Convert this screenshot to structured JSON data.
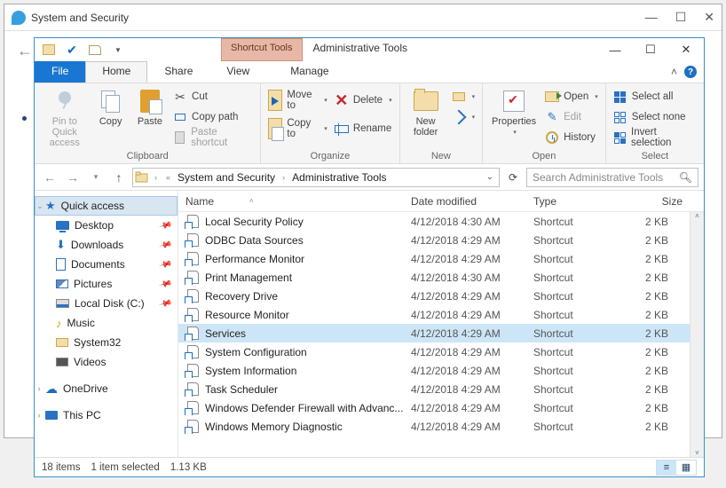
{
  "bg_window": {
    "title": "System and Security",
    "controls": {
      "min": "—",
      "max": "☐",
      "close": "✕"
    }
  },
  "window": {
    "context_tab": "Shortcut Tools",
    "title": "Administrative Tools",
    "controls": {
      "min": "—",
      "max": "☐",
      "close": "✕"
    }
  },
  "ribbon_tabs": {
    "file": "File",
    "home": "Home",
    "share": "Share",
    "view": "View",
    "manage": "Manage"
  },
  "ribbon": {
    "clipboard": {
      "label": "Clipboard",
      "pin": "Pin to Quick\naccess",
      "copy": "Copy",
      "paste": "Paste",
      "cut": "Cut",
      "copy_path": "Copy path",
      "paste_shortcut": "Paste shortcut"
    },
    "organize": {
      "label": "Organize",
      "move_to": "Move to",
      "copy_to": "Copy to",
      "delete": "Delete",
      "rename": "Rename"
    },
    "new": {
      "label": "New",
      "new_folder": "New\nfolder",
      "new_item": "New item",
      "easy_access": "Easy access"
    },
    "open": {
      "label": "Open",
      "properties": "Properties",
      "open": "Open",
      "edit": "Edit",
      "history": "History"
    },
    "select": {
      "label": "Select",
      "select_all": "Select all",
      "select_none": "Select none",
      "invert": "Invert selection"
    }
  },
  "addrbar": {
    "crumbs": [
      "System and Security",
      "Administrative Tools"
    ],
    "search_placeholder": "Search Administrative Tools"
  },
  "nav": {
    "quick_access": "Quick access",
    "items": [
      {
        "label": "Desktop",
        "pinned": true
      },
      {
        "label": "Downloads",
        "pinned": true
      },
      {
        "label": "Documents",
        "pinned": true
      },
      {
        "label": "Pictures",
        "pinned": true
      },
      {
        "label": "Local Disk (C:)",
        "pinned": true
      },
      {
        "label": "Music",
        "pinned": false
      },
      {
        "label": "System32",
        "pinned": false
      },
      {
        "label": "Videos",
        "pinned": false
      }
    ],
    "onedrive": "OneDrive",
    "this_pc": "This PC"
  },
  "columns": {
    "name": "Name",
    "date": "Date modified",
    "type": "Type",
    "size": "Size"
  },
  "files": [
    {
      "name": "Local Security Policy",
      "date": "4/12/2018 4:30 AM",
      "type": "Shortcut",
      "size": "2 KB",
      "selected": false
    },
    {
      "name": "ODBC Data Sources",
      "date": "4/12/2018 4:29 AM",
      "type": "Shortcut",
      "size": "2 KB",
      "selected": false
    },
    {
      "name": "Performance Monitor",
      "date": "4/12/2018 4:29 AM",
      "type": "Shortcut",
      "size": "2 KB",
      "selected": false
    },
    {
      "name": "Print Management",
      "date": "4/12/2018 4:30 AM",
      "type": "Shortcut",
      "size": "2 KB",
      "selected": false
    },
    {
      "name": "Recovery Drive",
      "date": "4/12/2018 4:29 AM",
      "type": "Shortcut",
      "size": "2 KB",
      "selected": false
    },
    {
      "name": "Resource Monitor",
      "date": "4/12/2018 4:29 AM",
      "type": "Shortcut",
      "size": "2 KB",
      "selected": false
    },
    {
      "name": "Services",
      "date": "4/12/2018 4:29 AM",
      "type": "Shortcut",
      "size": "2 KB",
      "selected": true
    },
    {
      "name": "System Configuration",
      "date": "4/12/2018 4:29 AM",
      "type": "Shortcut",
      "size": "2 KB",
      "selected": false
    },
    {
      "name": "System Information",
      "date": "4/12/2018 4:29 AM",
      "type": "Shortcut",
      "size": "2 KB",
      "selected": false
    },
    {
      "name": "Task Scheduler",
      "date": "4/12/2018 4:29 AM",
      "type": "Shortcut",
      "size": "2 KB",
      "selected": false
    },
    {
      "name": "Windows Defender Firewall with Advanc...",
      "date": "4/12/2018 4:29 AM",
      "type": "Shortcut",
      "size": "2 KB",
      "selected": false
    },
    {
      "name": "Windows Memory Diagnostic",
      "date": "4/12/2018 4:29 AM",
      "type": "Shortcut",
      "size": "2 KB",
      "selected": false
    }
  ],
  "status": {
    "count": "18 items",
    "selected": "1 item selected",
    "size": "1.13 KB"
  }
}
